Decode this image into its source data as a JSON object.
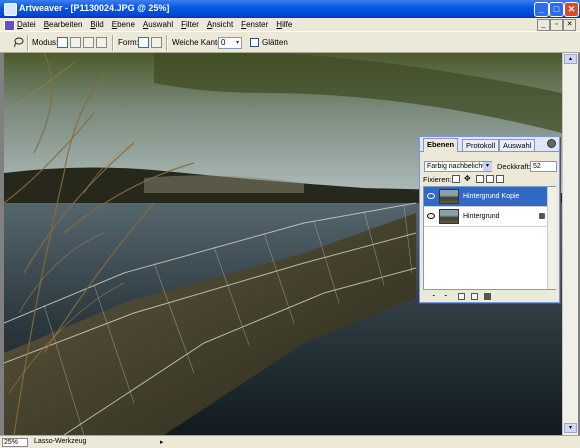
{
  "window": {
    "title": "Artweaver - [P1130024.JPG @ 25%]",
    "controls": {
      "minimize": "_",
      "maximize": "□",
      "close": "✕"
    }
  },
  "menu": {
    "items": [
      "Datei",
      "Bearbeiten",
      "Bild",
      "Ebene",
      "Auswahl",
      "Filter",
      "Ansicht",
      "Fenster",
      "Hilfe"
    ],
    "doc_controls": {
      "minimize": "_",
      "restore": "▫",
      "close": "✕"
    }
  },
  "options": {
    "modus_label": "Modus:",
    "form_label": "Form:",
    "weiche_kante_label": "Weiche Kante:",
    "weiche_kante_value": "0",
    "glaetten_label": "Glätten"
  },
  "layers_panel": {
    "tabs": [
      "Ebenen",
      "Protokoll",
      "Auswahl"
    ],
    "active_tab": 0,
    "blend_mode": "Farbig nachbelichten",
    "opacity_label": "Deckkraft:",
    "opacity_value": "52",
    "fix_label": "Fixieren:",
    "layers": [
      {
        "name": "Hintergrund Kopie",
        "selected": true,
        "locked": false
      },
      {
        "name": "Hintergrund",
        "selected": false,
        "locked": true
      }
    ]
  },
  "status": {
    "zoom": "25%",
    "tool": "Lasso-Werkzeug",
    "arrow": "▸"
  },
  "colors": {
    "title_bar": "#0A5AE6",
    "selection": "#316ac5",
    "chrome": "#ECE9D8"
  },
  "icons": [
    "lasso-icon",
    "gear-icon",
    "eye-icon",
    "lock-icon",
    "new-layer-icon",
    "trash-icon",
    "folder-icon"
  ]
}
